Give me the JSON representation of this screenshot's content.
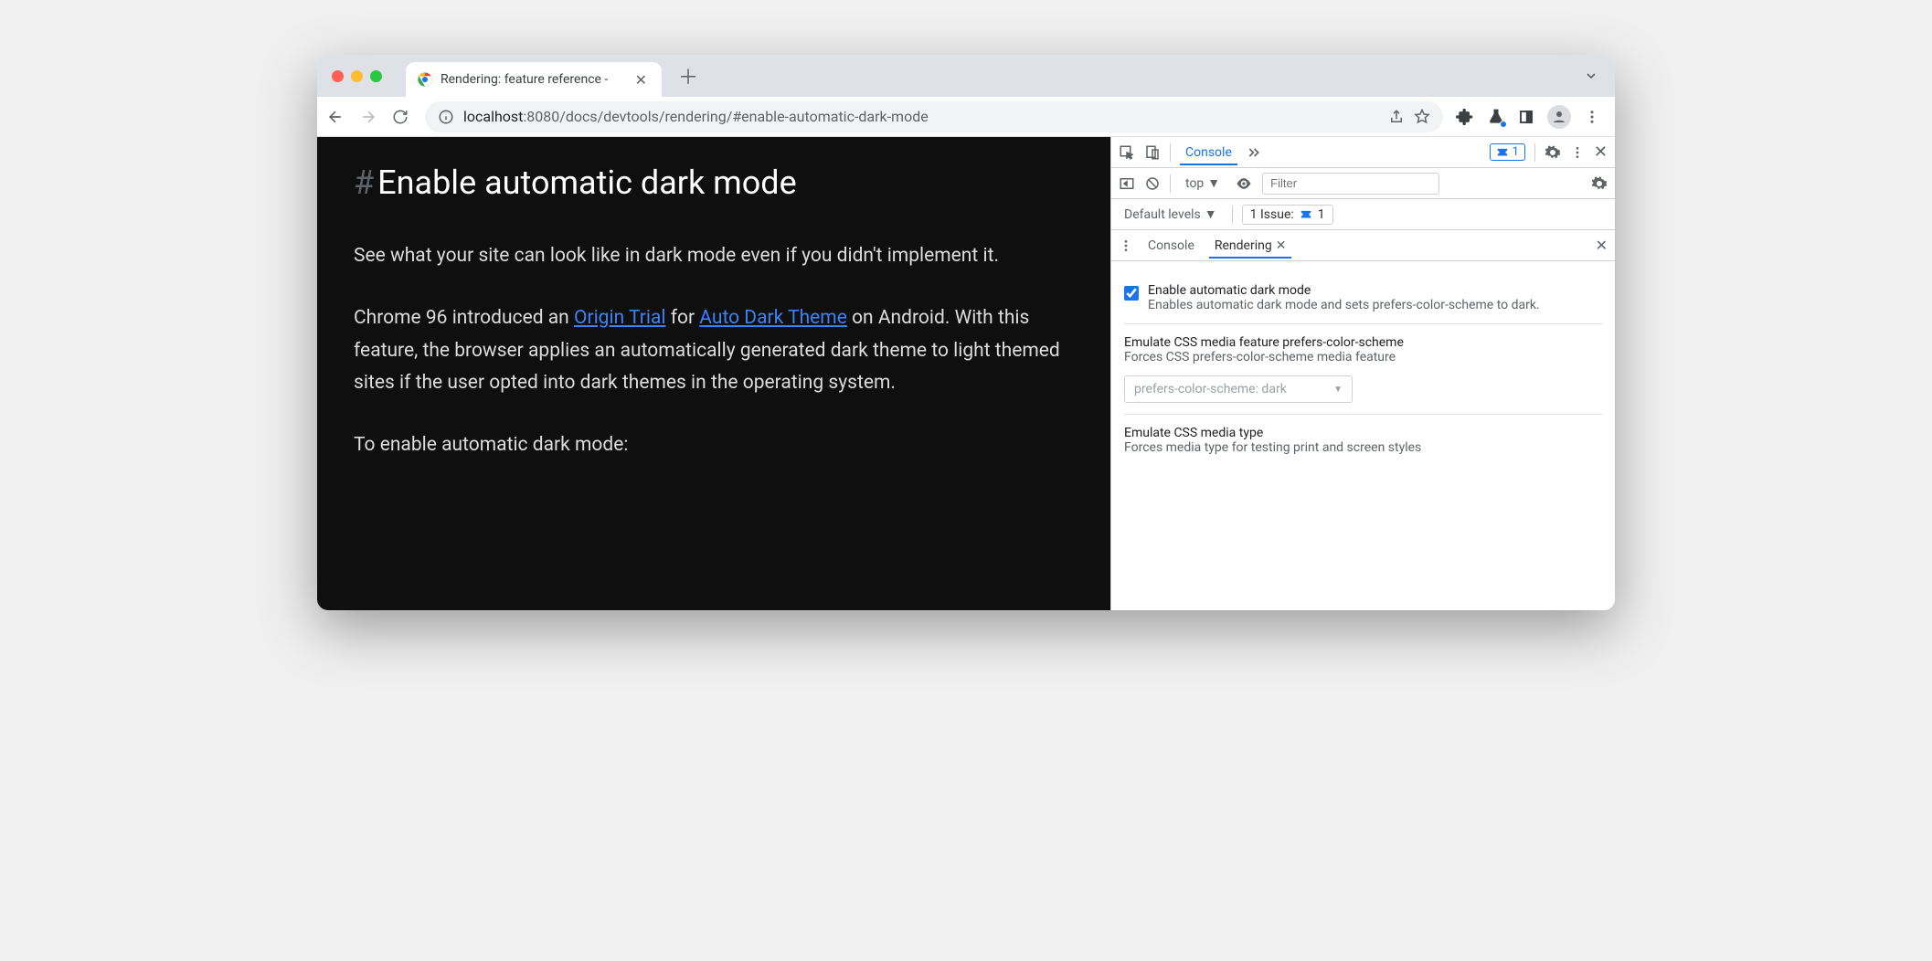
{
  "tab": {
    "title": "Rendering: feature reference -"
  },
  "omnibox": {
    "host": "localhost",
    "rest": ":8080/docs/devtools/rendering/#enable-automatic-dark-mode"
  },
  "page": {
    "heading": "Enable automatic dark mode",
    "p1": "See what your site can look like in dark mode even if you didn't implement it.",
    "p2a": "Chrome 96 introduced an ",
    "link1": "Origin Trial",
    "p2b": " for ",
    "link2": "Auto Dark Theme",
    "p2c": " on Android. With this feature, the browser applies an automatically generated dark theme to light themed sites if the user opted into dark themes in the operating system.",
    "p3": "To enable automatic dark mode:"
  },
  "devtools": {
    "mainTab": "Console",
    "badgeCount": "1",
    "context": "top",
    "filterPlaceholder": "Filter",
    "levels": "Default levels",
    "issuesLabel": "1 Issue:",
    "issuesCount": "1",
    "drawer": {
      "tab1": "Console",
      "tab2": "Rendering"
    },
    "settings": {
      "s1_title": "Enable automatic dark mode",
      "s1_desc": "Enables automatic dark mode and sets prefers-color-scheme to dark.",
      "s2_title": "Emulate CSS media feature prefers-color-scheme",
      "s2_desc": "Forces CSS prefers-color-scheme media feature",
      "s2_select": "prefers-color-scheme: dark",
      "s3_title": "Emulate CSS media type",
      "s3_desc": "Forces media type for testing print and screen styles"
    }
  }
}
